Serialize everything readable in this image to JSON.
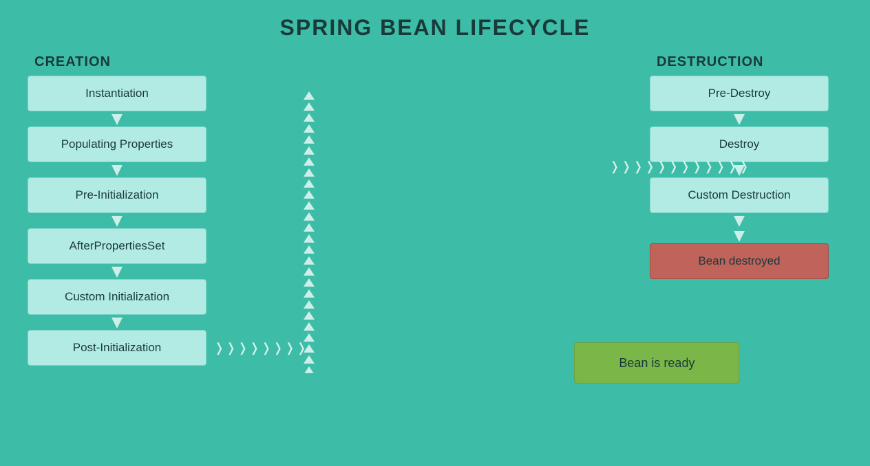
{
  "title": "SPRING BEAN LIFECYCLE",
  "creation": {
    "label": "CREATION",
    "steps": [
      "Instantiation",
      "Populating Properties",
      "Pre-Initialization",
      "AfterPropertiesSet",
      "Custom Initialization",
      "Post-Initialization"
    ]
  },
  "middle": {
    "bean_ready": "Bean is ready"
  },
  "destruction": {
    "label": "DESTRUCTION",
    "steps": [
      "Pre-Destroy",
      "Destroy",
      "Custom Destruction"
    ],
    "final": "Bean destroyed"
  }
}
